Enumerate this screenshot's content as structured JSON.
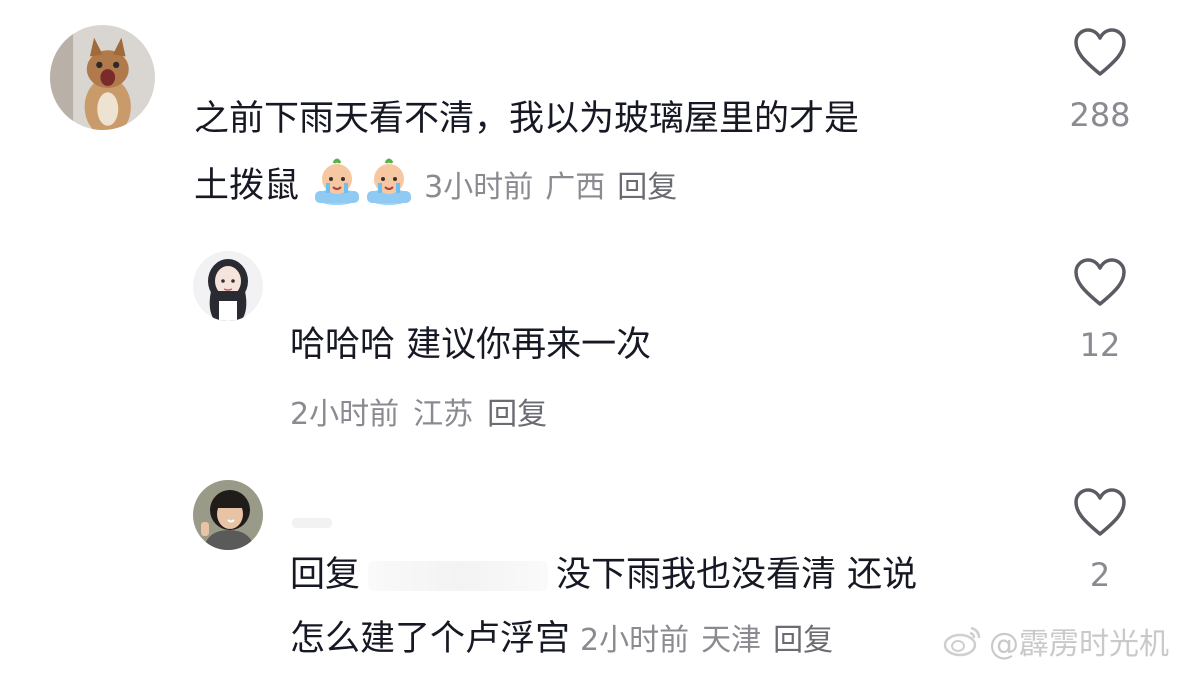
{
  "comments": [
    {
      "text_line1": "之前下雨天看不清，我以为玻璃屋里的才是",
      "text_line2": "土拨鼠",
      "time": "3小时前",
      "location": "广西",
      "reply_label": "回复",
      "likes": "288"
    },
    {
      "text": "哈哈哈 建议你再来一次",
      "time": "2小时前",
      "location": "江苏",
      "reply_label": "回复",
      "likes": "12"
    },
    {
      "reply_prefix": "回复",
      "text_line1": "没下雨我也没看清 还说",
      "text_line2": "怎么建了个卢浮宫",
      "time": "2小时前",
      "location": "天津",
      "reply_label": "回复",
      "likes": "2"
    }
  ],
  "watermark": "@霹雳时光机",
  "colors": {
    "text": "#161823",
    "meta": "#8a8b91",
    "icon": "#5a5b63"
  }
}
